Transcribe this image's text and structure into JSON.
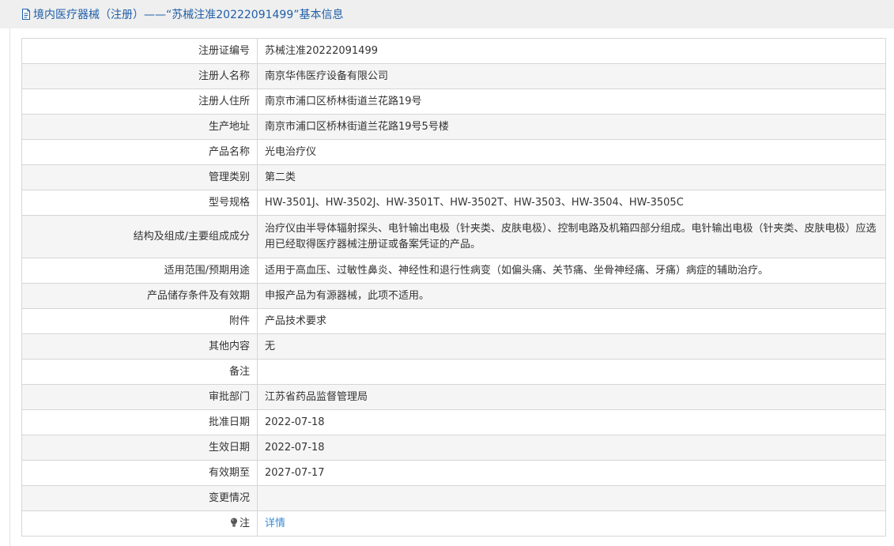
{
  "header": {
    "title": "境内医疗器械（注册）——“苏械注准20222091499”基本信息",
    "icon": "document-icon"
  },
  "colors": {
    "title_text": "#1f5fa8",
    "link": "#3a8ad6",
    "header_bg": "#efefef",
    "alt_row_bg": "#f5f5f5",
    "border": "#d6d6d6"
  },
  "rows": [
    {
      "label": "注册证编号",
      "value": "苏械注准20222091499"
    },
    {
      "label": "注册人名称",
      "value": "南京华伟医疗设备有限公司"
    },
    {
      "label": "注册人住所",
      "value": "南京市浦口区桥林街道兰花路19号"
    },
    {
      "label": "生产地址",
      "value": "南京市浦口区桥林街道兰花路19号5号楼"
    },
    {
      "label": "产品名称",
      "value": "光电治疗仪"
    },
    {
      "label": "管理类别",
      "value": "第二类"
    },
    {
      "label": "型号规格",
      "value": "HW-3501J、HW-3502J、HW-3501T、HW-3502T、HW-3503、HW-3504、HW-3505C"
    },
    {
      "label": "结构及组成/主要组成成分",
      "value": "治疗仪由半导体辐射探头、电针输出电极（针夹类、皮肤电极）、控制电路及机箱四部分组成。电针输出电极（针夹类、皮肤电极）应选用已经取得医疗器械注册证或备案凭证的产品。"
    },
    {
      "label": "适用范围/预期用途",
      "value": "适用于高血压、过敏性鼻炎、神经性和退行性病变（如偏头痛、关节痛、坐骨神经痛、牙痛）病症的辅助治疗。"
    },
    {
      "label": "产品储存条件及有效期",
      "value": "申报产品为有源器械，此项不适用。"
    },
    {
      "label": "附件",
      "value": "产品技术要求"
    },
    {
      "label": "其他内容",
      "value": "无"
    },
    {
      "label": "备注",
      "value": ""
    },
    {
      "label": "审批部门",
      "value": "江苏省药品监督管理局"
    },
    {
      "label": "批准日期",
      "value": "2022-07-18"
    },
    {
      "label": "生效日期",
      "value": "2022-07-18"
    },
    {
      "label": "有效期至",
      "value": "2027-07-17"
    },
    {
      "label": "变更情况",
      "value": ""
    }
  ],
  "note_row": {
    "label": "注",
    "icon": "lightbulb-icon",
    "link_text": "详情"
  }
}
